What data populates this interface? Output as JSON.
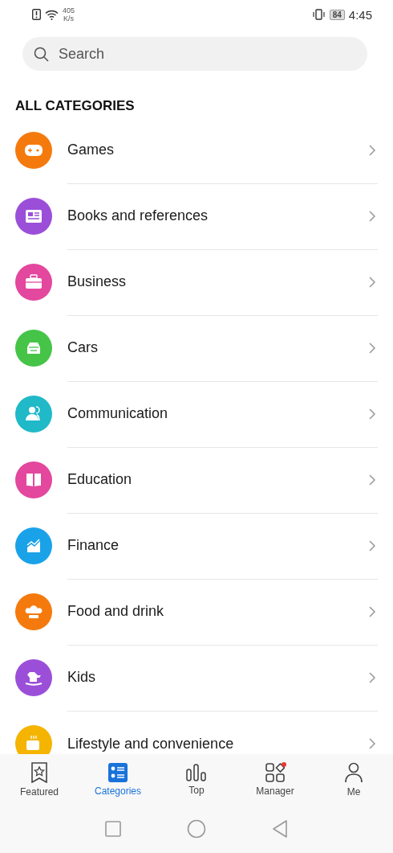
{
  "status_bar": {
    "speed_value": "405",
    "speed_unit": "K/s",
    "battery": "84",
    "time": "4:45"
  },
  "search": {
    "placeholder": "Search"
  },
  "section_title": "ALL CATEGORIES",
  "categories": [
    {
      "label": "Games",
      "color": "#f57a0d"
    },
    {
      "label": "Books and references",
      "color": "#9b4fd9"
    },
    {
      "label": "Business",
      "color": "#e3479e"
    },
    {
      "label": "Cars",
      "color": "#46c448"
    },
    {
      "label": "Communication",
      "color": "#1fb9c8"
    },
    {
      "label": "Education",
      "color": "#e3479e"
    },
    {
      "label": "Finance",
      "color": "#1aa2e8"
    },
    {
      "label": "Food and drink",
      "color": "#f57a0d"
    },
    {
      "label": "Kids",
      "color": "#9b4fd9"
    },
    {
      "label": "Lifestyle and convenience",
      "color": "#f5b400"
    }
  ],
  "tabs": [
    {
      "label": "Featured",
      "selected": false,
      "dot": false
    },
    {
      "label": "Categories",
      "selected": true,
      "dot": false
    },
    {
      "label": "Top",
      "selected": false,
      "dot": false
    },
    {
      "label": "Manager",
      "selected": false,
      "dot": true
    },
    {
      "label": "Me",
      "selected": false,
      "dot": false
    }
  ]
}
